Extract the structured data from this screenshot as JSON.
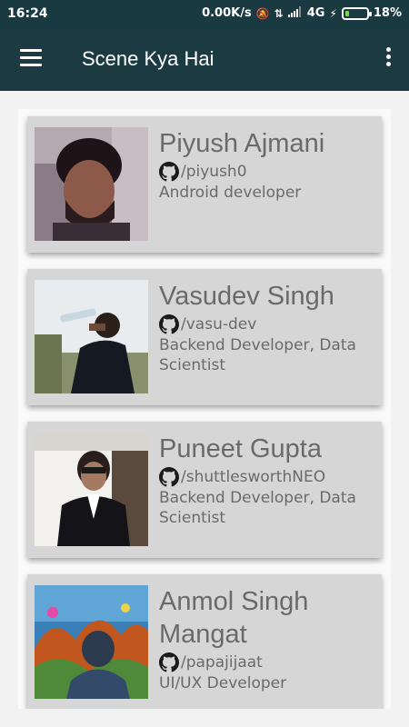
{
  "status_bar": {
    "time": "16:24",
    "net_speed": "0.00K/s",
    "network": "4G",
    "battery_percent": "18%",
    "battery_level": 0.18,
    "icons": [
      "alarm-off-icon",
      "data-transfer-icon",
      "signal-icon",
      "charging-icon",
      "battery-icon"
    ]
  },
  "app_bar": {
    "title": "Scene Kya Hai",
    "left_icon": "hamburger-menu-icon",
    "right_icon": "more-vert-icon"
  },
  "colors": {
    "app_bar": "#1b3a42",
    "card_bg": "#d6d6d6",
    "text": "#6a6a6a",
    "background": "#f2f2f2"
  },
  "team": [
    {
      "name": "Piyush Ajmani",
      "github": "/piyush0",
      "role": "Android developer",
      "icon": "github-icon"
    },
    {
      "name": "Vasudev Singh",
      "github": "/vasu-dev",
      "role": "Backend Developer, Data Scientist",
      "icon": "github-icon"
    },
    {
      "name": "Puneet Gupta",
      "github": "/shuttlesworthNEO",
      "role": "Backend Developer, Data Scientist",
      "icon": "github-icon"
    },
    {
      "name": "Anmol Singh Mangat",
      "github": "/papajijaat",
      "role": "UI/UX Developer",
      "icon": "github-icon"
    }
  ]
}
